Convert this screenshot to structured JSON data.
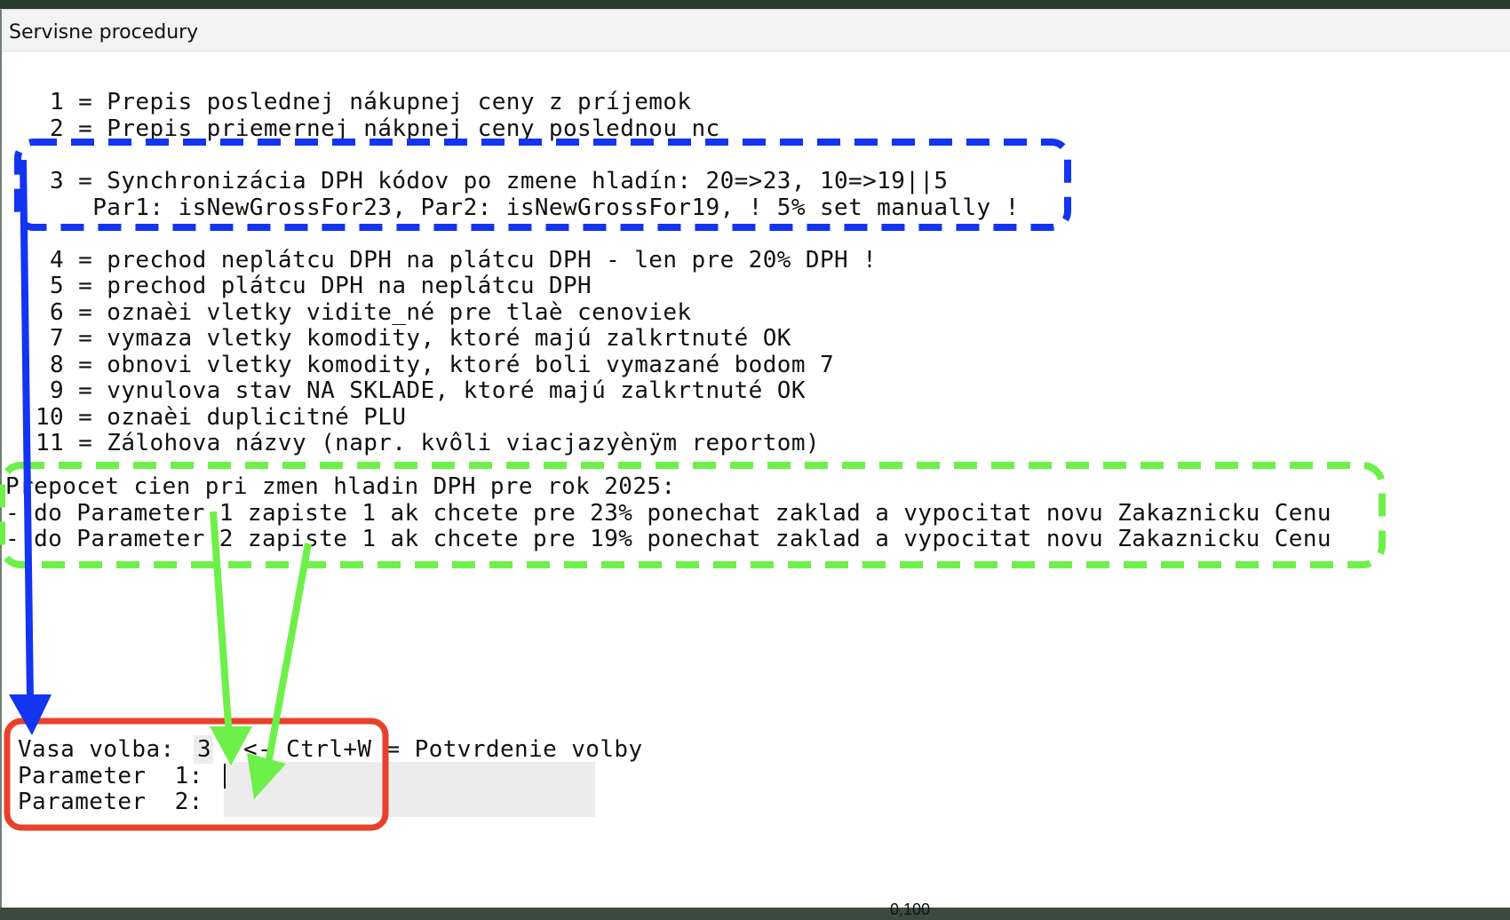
{
  "window": {
    "title": "Servisne procedury"
  },
  "menu": [
    {
      "key": " 1",
      "text": "Prepis poslednej nákupnej ceny z príjemok"
    },
    {
      "key": " 2",
      "text": "Prepis priemernej nákpnej ceny poslednou nc"
    },
    {
      "key": " 3",
      "text": "Synchronizácia DPH kódov po zmene hladín: 20=>23, 10=>19||5"
    },
    {
      "key": "",
      "text": "Par1: isNewGrossFor23, Par2: isNewGrossFor19, ! 5% set manually !"
    },
    {
      "key": " 4",
      "text": "prechod neplátcu DPH na plátcu DPH - len pre 20% DPH !"
    },
    {
      "key": " 5",
      "text": "prechod plátcu DPH na neplátcu DPH"
    },
    {
      "key": " 6",
      "text": "oznaèi vletky vidite_né pre tlaè cenoviek"
    },
    {
      "key": " 7",
      "text": "vymaza vletky komodity, ktoré majú zalkrtnuté OK"
    },
    {
      "key": " 8",
      "text": "obnovi vletky komodity, ktoré boli vymazané bodom 7"
    },
    {
      "key": " 9",
      "text": "vynulova stav NA SKLADE, ktoré majú zalkrtnuté OK"
    },
    {
      "key": "10",
      "text": "oznaèi duplicitné PLU"
    },
    {
      "key": "11",
      "text": "Zálohova názvy (napr. kvôli viacjazyènÿm reportom)"
    }
  ],
  "note": {
    "heading": "Prepocet cien pri zmen hladin DPH pre rok 2025:",
    "line1": "- do Parameter 1 zapiste 1 ak chcete pre 23% ponechat zaklad a vypocitat novu Zakaznicku Cenu",
    "line2": "- do Parameter 2 zapiste 1 ak chcete pre 19% ponechat zaklad a vypocitat novu Zakaznicku Cenu"
  },
  "form": {
    "choice_label": "Vasa volba:",
    "choice_value": "3",
    "hint": "<- Ctrl+W = Potvrdenie volby",
    "param1_label": "Parameter  1:",
    "param1_value": "",
    "param2_label": "Parameter  2:",
    "param2_value": ""
  },
  "taskbar": {
    "text": "0,100"
  },
  "colors": {
    "highlight_blue": "#1334f0",
    "highlight_green": "#6ef04a",
    "highlight_red": "#e8412b"
  }
}
